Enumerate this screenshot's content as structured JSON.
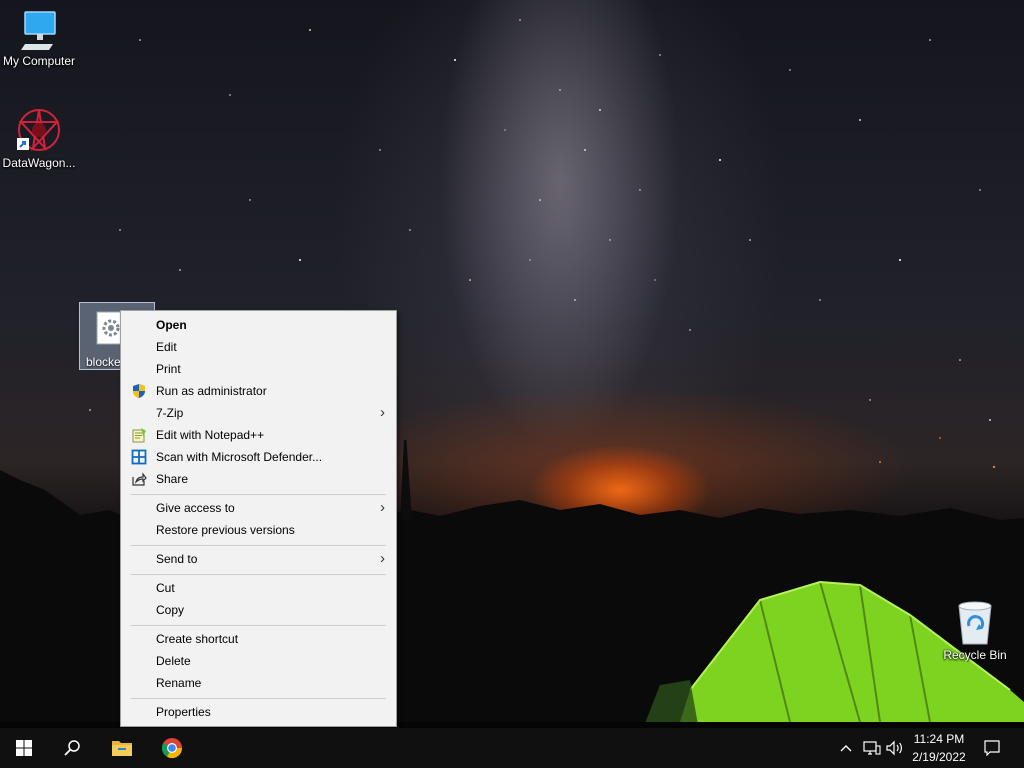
{
  "desktop": {
    "icons": [
      {
        "label": "My Computer",
        "icon": "monitor-icon"
      },
      {
        "label": "DataWagon...",
        "icon": "datawagon-shortcut-icon"
      },
      {
        "label": "blocke",
        "icon": "settings-file-icon"
      },
      {
        "label": "Recycle Bin",
        "icon": "recycle-bin-icon"
      }
    ]
  },
  "context_menu": {
    "items": [
      {
        "label": "Open",
        "bold": true
      },
      {
        "label": "Edit"
      },
      {
        "label": "Print"
      },
      {
        "label": "Run as administrator",
        "icon": "shield-icon"
      },
      {
        "label": "7-Zip",
        "submenu": true
      },
      {
        "label": "Edit with Notepad++",
        "icon": "notepadpp-icon"
      },
      {
        "label": "Scan with Microsoft Defender...",
        "icon": "defender-icon"
      },
      {
        "label": "Share",
        "icon": "share-icon"
      },
      {
        "label": "Give access to",
        "submenu": true
      },
      {
        "label": "Restore previous versions"
      },
      {
        "label": "Send to",
        "submenu": true
      },
      {
        "label": "Cut"
      },
      {
        "label": "Copy"
      },
      {
        "label": "Create shortcut"
      },
      {
        "label": "Delete"
      },
      {
        "label": "Rename"
      },
      {
        "label": "Properties"
      }
    ],
    "submenu_arrow": "›"
  },
  "taskbar": {
    "buttons": [
      "windows-start-icon",
      "search-icon",
      "file-explorer-icon",
      "chrome-icon"
    ],
    "tray_icons": [
      "chevron-up-icon",
      "network-icon",
      "volume-icon"
    ],
    "time": "11:24 PM",
    "date": "2/19/2022",
    "notification_icon": "action-center-icon"
  },
  "colors": {
    "menu_background": "#f2f2f2",
    "taskbar": "#101010",
    "tent_green": "#7ed321"
  }
}
